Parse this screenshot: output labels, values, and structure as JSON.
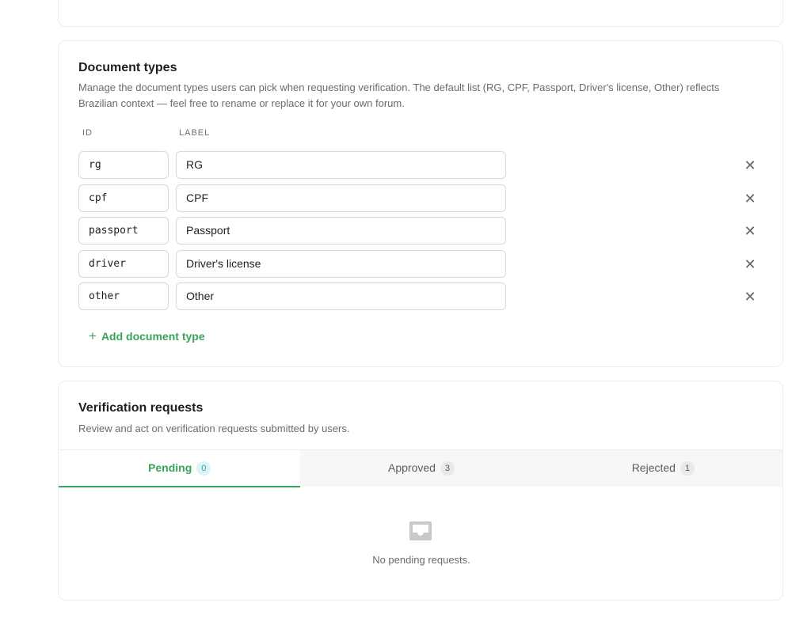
{
  "document_types": {
    "title": "Document types",
    "description": "Manage the document types users can pick when requesting verification. The default list (RG, CPF, Passport, Driver's license, Other) reflects Brazilian context — feel free to rename or replace it for your own forum.",
    "columns": {
      "id": "ID",
      "label": "LABEL"
    },
    "rows": [
      {
        "id": "rg",
        "label": "RG"
      },
      {
        "id": "cpf",
        "label": "CPF"
      },
      {
        "id": "passport",
        "label": "Passport"
      },
      {
        "id": "driver",
        "label": "Driver's license"
      },
      {
        "id": "other",
        "label": "Other"
      }
    ],
    "remove_icon": "close-icon",
    "add_label": "Add document type",
    "add_icon": "plus-icon"
  },
  "verification_requests": {
    "title": "Verification requests",
    "description": "Review and act on verification requests submitted by users.",
    "tabs": [
      {
        "label": "Pending",
        "count": "0",
        "active": true
      },
      {
        "label": "Approved",
        "count": "3",
        "active": false
      },
      {
        "label": "Rejected",
        "count": "1",
        "active": false
      }
    ],
    "empty_icon": "inbox-icon",
    "empty_text": "No pending requests."
  },
  "colors": {
    "accent": "#3aa35b",
    "badge_active_bg": "#dff4f5",
    "badge_bg": "#e9e9e9"
  }
}
